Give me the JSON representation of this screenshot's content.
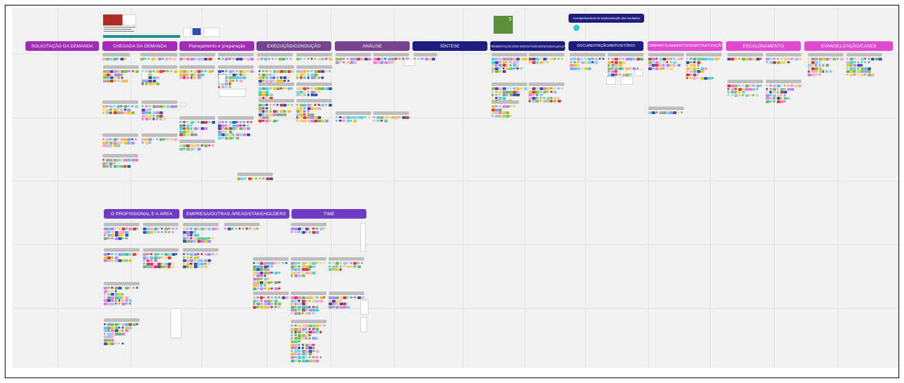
{
  "colors": {
    "purple": "#9c27b0",
    "dark_purple": "#6c3e8c",
    "mauve": "#76438f",
    "navy": "#1d1d7f",
    "magenta": "#e149d1",
    "violet": "#6f3bc4",
    "card_gray": "#bdbdbd",
    "canvas": "#f1f1f1"
  },
  "phases": [
    {
      "label": "SOLICITAÇÃO DA DEMANDA",
      "color": "#a22bb5"
    },
    {
      "label": "CHEGADA DA DEMANDA",
      "color": "#a22bb5"
    },
    {
      "label": "Planejamento e preparação",
      "color": "#a22bb5"
    },
    {
      "label": "EXECUÇÃO/CONDUÇÃO",
      "color": "#76438f"
    },
    {
      "label": "ANÁLISE",
      "color": "#76438f"
    },
    {
      "label": "SÍNTESE",
      "color": "#1d1d7f"
    },
    {
      "label": "APRESENTAÇÃO DOS INSIGHTS/DADOS/VISUALIZAÇÃO",
      "color": "#1d1d7f"
    },
    {
      "label": "DOCUMENTAÇÃO/REPOSITÓRIO",
      "color": "#1d1d7f"
    },
    {
      "label": "COMPARTILHAMENTO/DEMOTRATIZAÇÃO",
      "color": "#e149d1"
    },
    {
      "label": "ESCALONAMENTO",
      "color": "#e149d1"
    },
    {
      "label": "EVANGELIZAÇÃO/CASES",
      "color": "#e149d1"
    }
  ],
  "groups": [
    {
      "label": "O PROFISSIONAL E A ÁREA",
      "color": "#6f3bc4"
    },
    {
      "label": "EMPRESA/OUTRAS ÁREAS/STAKEHOLDERS",
      "color": "#6f3bc4"
    },
    {
      "label": "TIME",
      "color": "#6f3bc4"
    }
  ],
  "tracking_label": "Acompanhamento de implementação dos resultados",
  "green_card_text": "5",
  "sticky_palette": [
    "#f5c518",
    "#4dd0e1",
    "#8bc34a",
    "#e57edc",
    "#a78bfa",
    "#7dd3fc",
    "#f9a8d4",
    "#e53935",
    "#3f51b5",
    "#66bb6a",
    "#ffcc80"
  ]
}
